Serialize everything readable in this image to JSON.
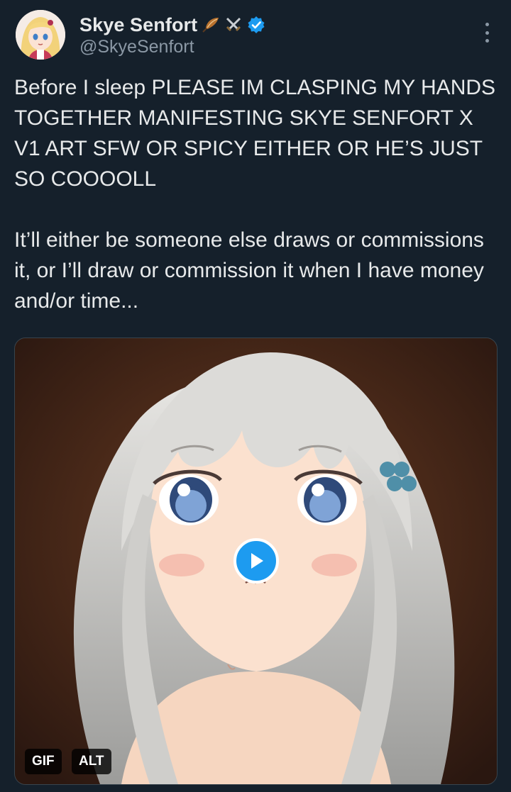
{
  "author": {
    "display_name": "Skye Senfort",
    "handle": "@SkyeSenfort",
    "verified": true,
    "name_emojis": [
      "feather-emoji",
      "crossed-swords-emoji"
    ],
    "avatar": "anime-girl-avatar"
  },
  "tweet": {
    "paragraph_1": "Before I sleep PLEASE IM CLASPING MY HANDS TOGETHER MANIFESTING SKYE SENFORT X V1 ART SFW OR SPICY EITHER OR HE’S JUST SO COOOOLL",
    "paragraph_2": "It’ll either be someone else draws or commissions it, or I’ll draw or commission it when I have money and/or time..."
  },
  "media": {
    "type": "gif",
    "gif_badge": "GIF",
    "alt_badge": "ALT",
    "play_icon": "play-icon"
  },
  "colors": {
    "background": "#15202b",
    "text": "#e7e9ea",
    "secondary_text": "#8b98a5",
    "accent": "#1d9bf0"
  }
}
